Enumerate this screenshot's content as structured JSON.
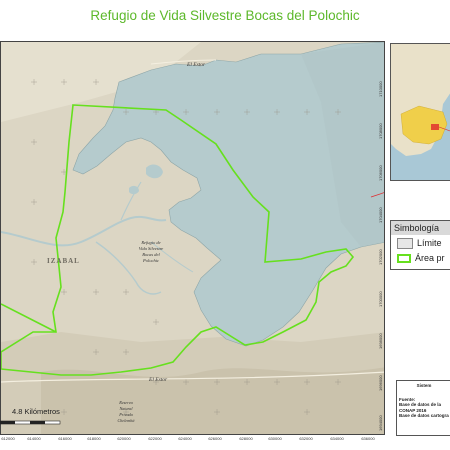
{
  "title": "Refugio de Vida Silvestre Bocas del Polochic",
  "map": {
    "place_labels": {
      "el_estor_top": "El Estor",
      "el_estor_bottom": "El Estor",
      "izabal": "IZABAL",
      "refugio": [
        "Refugio de",
        "Vida Silvestre",
        "Bocas del",
        "Polochic"
      ],
      "reserva": [
        "Reserva",
        "Natural",
        "Privada",
        "Chelemhá"
      ]
    },
    "x_ticks": [
      "612000",
      "614000",
      "616000",
      "618000",
      "620000",
      "622000",
      "624000",
      "626000",
      "628000",
      "630000",
      "632000",
      "634000",
      "636000"
    ],
    "y_ticks": [
      "1710000",
      "1708000",
      "1706000",
      "1704000",
      "1702000",
      "1700000",
      "1698000",
      "1696000",
      "1694000"
    ],
    "scale_label": "4.8 Kilómetros",
    "colors": {
      "water": "#b5cbcd",
      "land": "#dcd6c4",
      "boundary": "#66e01e",
      "title": "#5cb82a"
    }
  },
  "legend": {
    "title": "Simbología",
    "items": [
      {
        "label": "Límite",
        "color": "#e6e6e6"
      },
      {
        "label": "Área pr",
        "color": "#66e01e"
      }
    ]
  },
  "info": {
    "title": "Sistem",
    "lines": [
      "Fuente:",
      "Base de datos de la",
      "CONAP 2016",
      "Base de datos cartogra"
    ]
  }
}
